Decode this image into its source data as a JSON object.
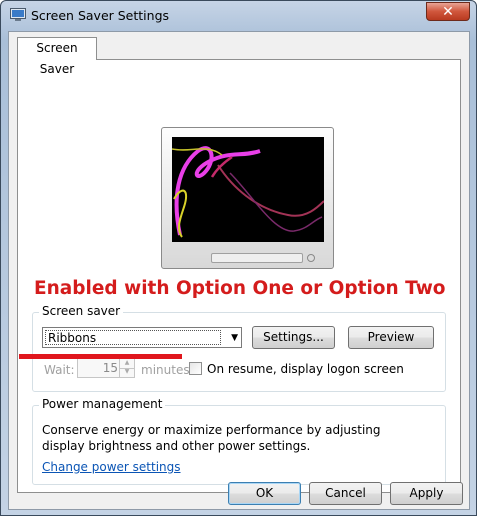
{
  "window": {
    "title": "Screen Saver Settings",
    "close_glyph": "✕",
    "icon": "screen-saver-app-icon"
  },
  "tabs": [
    {
      "label": "Screen Saver",
      "selected": true
    }
  ],
  "annotation": {
    "banner_text": "Enabled with Option One or Option Two",
    "color": "#d41c1c"
  },
  "screen_saver": {
    "group_title": "Screen saver",
    "selected": "Ribbons",
    "settings_label": "Settings...",
    "preview_label": "Preview",
    "wait_label": "Wait:",
    "wait_value": "15",
    "wait_units": "minutes",
    "resume_label": "On resume, display logon screen",
    "resume_checked": false
  },
  "power": {
    "group_title": "Power management",
    "description": "Conserve energy or maximize performance by adjusting display brightness and other power settings.",
    "link_label": "Change power settings"
  },
  "footer": {
    "ok_label": "OK",
    "cancel_label": "Cancel",
    "apply_label": "Apply"
  }
}
